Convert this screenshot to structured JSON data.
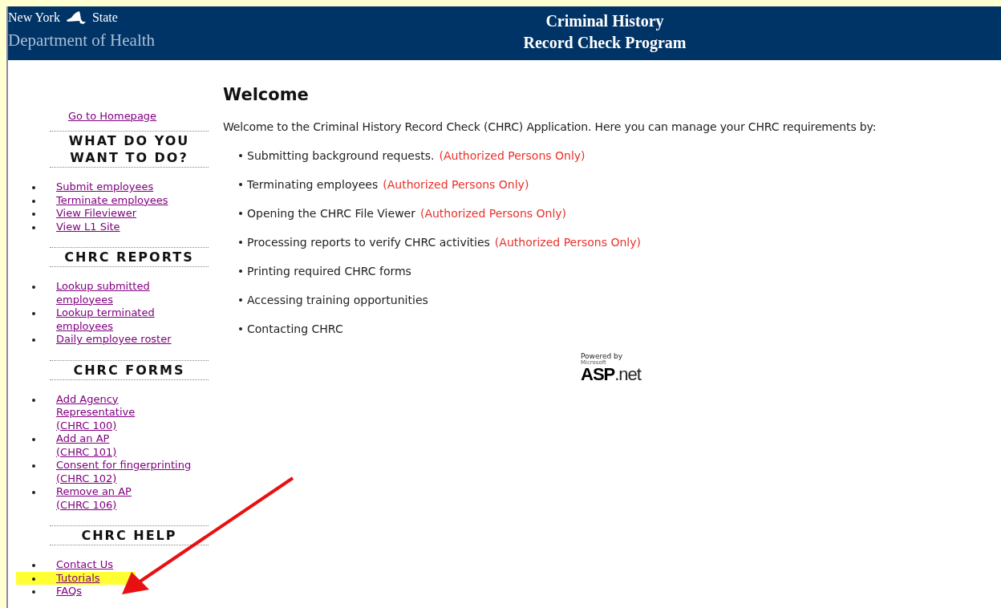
{
  "header": {
    "state_words": [
      "New York",
      "State"
    ],
    "department": "Department of Health",
    "title_lines": [
      "Criminal History",
      "Record Check Program"
    ]
  },
  "sidebar": {
    "home_link": "Go to Homepage",
    "sections": [
      {
        "heading": "WHAT DO YOU WANT TO DO?",
        "items": [
          {
            "lines": [
              "Submit employees"
            ],
            "highlighted": false
          },
          {
            "lines": [
              "Terminate employees"
            ],
            "highlighted": false
          },
          {
            "lines": [
              "View Fileviewer"
            ],
            "highlighted": false
          },
          {
            "lines": [
              "View L1 Site"
            ],
            "highlighted": false
          }
        ]
      },
      {
        "heading": "CHRC REPORTS",
        "items": [
          {
            "lines": [
              "Lookup submitted",
              "employees"
            ],
            "highlighted": false
          },
          {
            "lines": [
              "Lookup terminated",
              "employees"
            ],
            "highlighted": false
          },
          {
            "lines": [
              "Daily employee roster"
            ],
            "highlighted": false
          }
        ]
      },
      {
        "heading": "CHRC FORMS",
        "items": [
          {
            "lines": [
              "Add Agency",
              "Representative",
              "(CHRC 100)"
            ],
            "highlighted": false
          },
          {
            "lines": [
              "Add an AP",
              "(CHRC 101)"
            ],
            "highlighted": false
          },
          {
            "lines": [
              "Consent for fingerprinting",
              "(CHRC 102)"
            ],
            "highlighted": false
          },
          {
            "lines": [
              "Remove an AP",
              "(CHRC 106)"
            ],
            "highlighted": false
          }
        ]
      },
      {
        "heading": "CHRC HELP",
        "items": [
          {
            "lines": [
              "Contact Us"
            ],
            "highlighted": false
          },
          {
            "lines": [
              "Tutorials"
            ],
            "highlighted": true
          },
          {
            "lines": [
              "FAQs"
            ],
            "highlighted": false
          }
        ]
      }
    ]
  },
  "main": {
    "title": "Welcome",
    "intro": "Welcome to the Criminal History Record Check (CHRC) Application. Here you can manage your CHRC requirements by:",
    "items": [
      {
        "text": "Submitting background requests.",
        "note": "(Authorized Persons Only)"
      },
      {
        "text": "Terminating employees",
        "note": "(Authorized Persons Only)"
      },
      {
        "text": "Opening the CHRC File Viewer",
        "note": "(Authorized Persons Only)"
      },
      {
        "text": "Processing reports to verify CHRC activities",
        "note": "(Authorized Persons Only)"
      },
      {
        "text": "Printing required CHRC forms"
      },
      {
        "text": "Accessing training opportunities"
      },
      {
        "text": "Contacting CHRC"
      }
    ],
    "badge": {
      "top": "Powered by",
      "small": "Microsoft",
      "brand": "ASP",
      "suffix": ".net"
    }
  }
}
